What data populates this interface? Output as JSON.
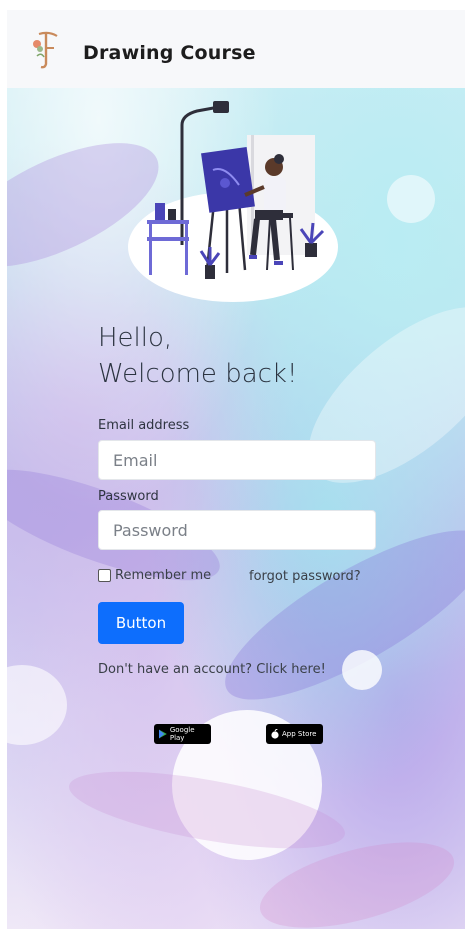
{
  "navbar": {
    "title": "Drawing Course",
    "logo_icon": "letter-f-logo-icon"
  },
  "hero": {
    "illustration": "artist-painting-at-easel-illustration"
  },
  "greeting": {
    "line1": "Hello,",
    "line2": "Welcome back!"
  },
  "form": {
    "email_label": "Email address",
    "email_placeholder": "Email",
    "password_label": "Password",
    "password_placeholder": "Password",
    "remember_label": "Remember me",
    "forgot_label": "forgot password?",
    "submit_label": "Button",
    "signup_text": "Don't have an account? Click here!"
  },
  "stores": {
    "google_play": "Google Play",
    "app_store": "App Store"
  },
  "colors": {
    "primary": "#0d6efd",
    "navbar_bg": "#f7f8fa"
  }
}
